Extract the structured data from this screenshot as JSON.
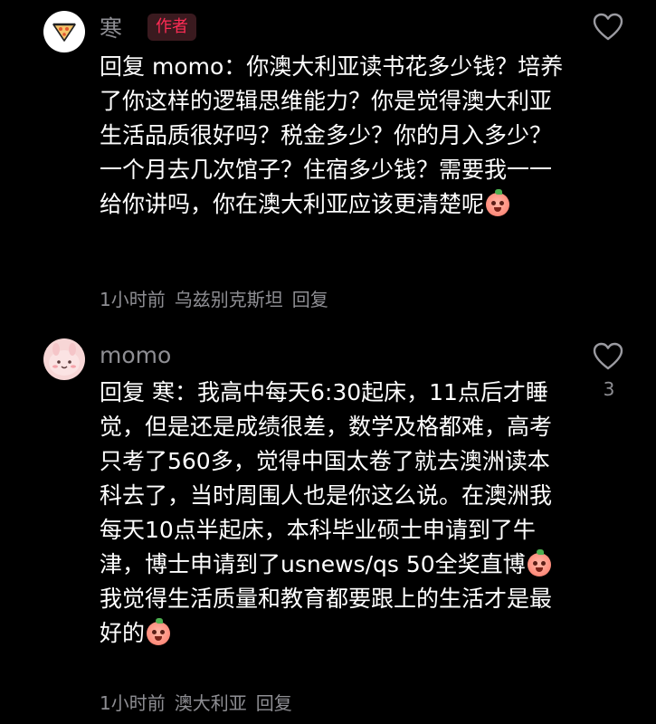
{
  "comments": [
    {
      "username": "寒",
      "badge": "作者",
      "reply_label": "回复",
      "reply_target": "momo",
      "segments": [
        "：你澳大利亚读书花多少钱？培养了你这样的逻辑思维能力？你是觉得澳大利亚生活品质很好吗？税金多少？你的月入多少？一个月去几次馆子？住宿多少钱？需要我一一给你讲吗，你在澳大利亚应该更清楚呢"
      ],
      "time": "1小时前",
      "location": "乌兹别克斯坦",
      "reply_action": "回复",
      "like_count": "",
      "emoji_names": [
        "peach-laugh-emoji"
      ]
    },
    {
      "username": "momo",
      "badge": "",
      "reply_label": "回复",
      "reply_target": "寒",
      "segments": [
        "：我高中每天6:30起床，11点后才睡觉，但是还是成绩很差，数学及格都难，高考只考了560多，觉得中国太卷了就去澳洲读本科去了，当时周围人也是你这么说。在澳洲我每天10点半起床，本科毕业硕士申请到了牛津，博士申请到了usnews/qs 50全奖直博",
        " 我觉得生活质量和教育都要跟上的生活才是最好的"
      ],
      "time": "1小时前",
      "location": "澳大利亚",
      "reply_action": "回复",
      "like_count": "3",
      "emoji_names": [
        "peach-cry-emoji",
        "peach-cry-emoji"
      ]
    }
  ],
  "icons": {
    "like": "heart-outline-icon",
    "avatar_1": "pizza-slice-icon",
    "avatar_2": "pink-bunny-icon"
  },
  "colors": {
    "background": "#000000",
    "text": "#ffffff",
    "meta": "#8e8e93",
    "author_badge": "#fe2c55"
  }
}
